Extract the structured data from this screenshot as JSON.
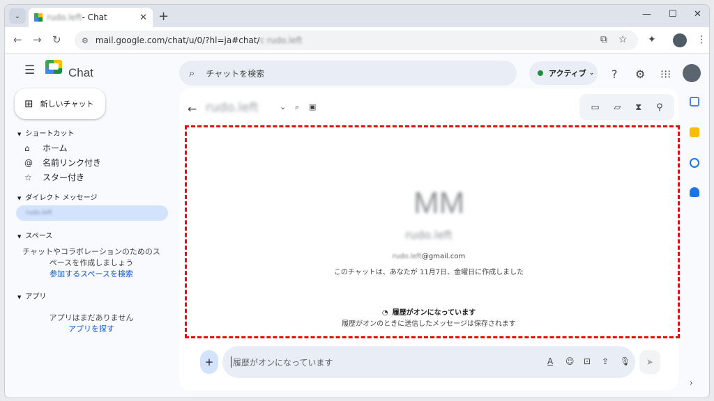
{
  "browser": {
    "tab_title_blurred": "rudo.left",
    "tab_title_suffix": "- Chat",
    "url_prefix": "mail.google.com/chat/u/0/?hl=ja#chat/",
    "url_blurred": "c  rudo.left"
  },
  "header": {
    "app_name": "Chat",
    "search_placeholder": "チャットを検索",
    "status_label": "アクティブ",
    "status_color": "#1e8e3e"
  },
  "sidebar": {
    "new_chat_label": "新しいチャット",
    "shortcuts_head": "ショートカット",
    "shortcuts": [
      {
        "label": "ホーム",
        "icon": "home-icon"
      },
      {
        "label": "名前リンク付き",
        "icon": "at-icon"
      },
      {
        "label": "スター付き",
        "icon": "star-icon"
      }
    ],
    "dm_head": "ダイレクト メッセージ",
    "dm_blurred": "rudo.left",
    "spaces_head": "スペース",
    "spaces_empty_line1": "チャットやコラボレーションのためのス",
    "spaces_empty_line2": "ペースを作成しましょう",
    "spaces_link": "参加するスペースを検索",
    "apps_head": "アプリ",
    "apps_empty": "アプリはまだありません",
    "apps_link": "アプリを探す"
  },
  "chat": {
    "title_blurred": "rudo.left",
    "initials_blurred": "MM",
    "name_blurred": "rudo.left",
    "email_blurred": "rudo.left",
    "email_suffix": "@gmail.com",
    "created_text": "このチャットは、あなたが 11月7日、金曜日に作成しました",
    "history_title": "履歴がオンになっています",
    "history_sub": "履歴がオンのときに送信したメッセージは保存されます",
    "composer_placeholder": "履歴がオンになっています"
  },
  "colors": {
    "accent_blue": "#0b57d0",
    "highlight_frame": "#e01010",
    "selected_dm": "#d3e3fd"
  }
}
